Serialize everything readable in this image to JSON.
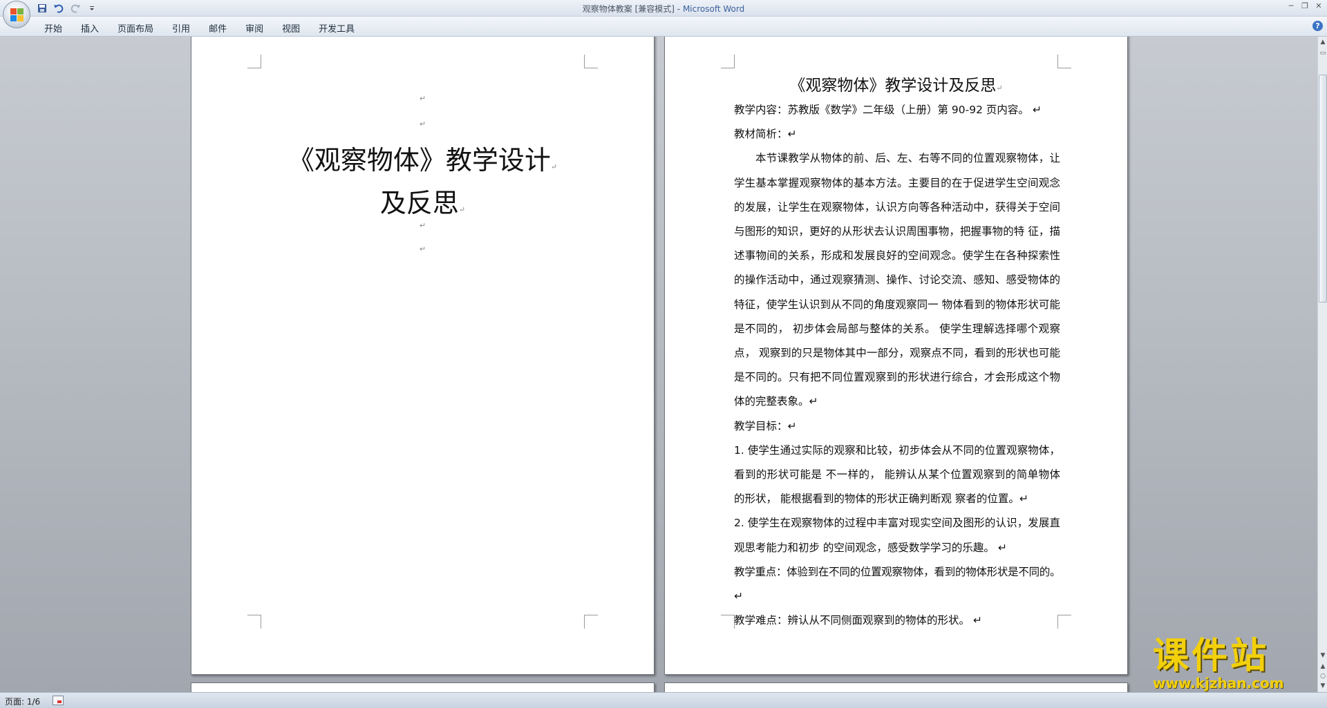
{
  "window": {
    "doc_title": "观察物体教案 [兼容模式]",
    "separator": " - ",
    "app_name": "Microsoft Word",
    "controls": [
      "─",
      "❐",
      "✕"
    ]
  },
  "qat": {
    "icons": [
      "save-icon",
      "undo-icon",
      "redo-icon",
      "customize-icon"
    ]
  },
  "ribbon": {
    "tabs": [
      {
        "label": "开始"
      },
      {
        "label": "插入"
      },
      {
        "label": "页面布局"
      },
      {
        "label": "引用"
      },
      {
        "label": "邮件"
      },
      {
        "label": "审阅"
      },
      {
        "label": "视图"
      },
      {
        "label": "开发工具"
      }
    ],
    "help": "?"
  },
  "page1": {
    "para_mark": "↵",
    "title_line1": "《观察物体》教学设计",
    "title_line2": "及反思"
  },
  "page2": {
    "title": "《观察物体》教学设计及反思",
    "paragraphs": [
      "教学内容：苏教版《数学》二年级（上册）第 90-92 页内容。 ↵",
      "教材简析：↵",
      "本节课教学从物体的前、后、左、右等不同的位置观察物体，让学生基本掌握观察物体的基本方法。主要目的在于促进学生空间观念的发展，让学生在观察物体，认识方向等各种活动中，获得关于空间与图形的知识，更好的从形状去认识周围事物，把握事物的特 征，描述事物间的关系，形成和发展良好的空间观念。使学生在各种探索性的操作活动中，通过观察猜测、操作、讨论交流、感知、感受物体的特征，使学生认识到从不同的角度观察同一 物体看到的物体形状可能是不同的， 初步体会局部与整体的关系。 使学生理解选择哪个观察点， 观察到的只是物体其中一部分，观察点不同，看到的形状也可能是不同的。只有把不同位置观察到的形状进行综合，才会形成这个物体的完整表象。↵",
      "教学目标：↵",
      "1. 使学生通过实际的观察和比较，初步体会从不同的位置观察物体，看到的形状可能是 不一样的， 能辨认从某个位置观察到的简单物体的形状， 能根据看到的物体的形状正确判断观 察者的位置。↵",
      "2. 使学生在观察物体的过程中丰富对现实空间及图形的认识，发展直观思考能力和初步 的空间观念，感受数学学习的乐趣。 ↵",
      "教学重点：体验到在不同的位置观察物体，看到的物体形状是不同的。↵",
      "教学难点：辨认从不同侧面观察到的物体的形状。 ↵"
    ]
  },
  "statusbar": {
    "page_info": "页面: 1/6"
  },
  "watermark": {
    "title": "课件站",
    "url": "www.kjzhan.com"
  },
  "colors": {
    "accent": "#3b73c5",
    "watermark": "#f2d00c",
    "doc_bg": "#a8adb5"
  }
}
